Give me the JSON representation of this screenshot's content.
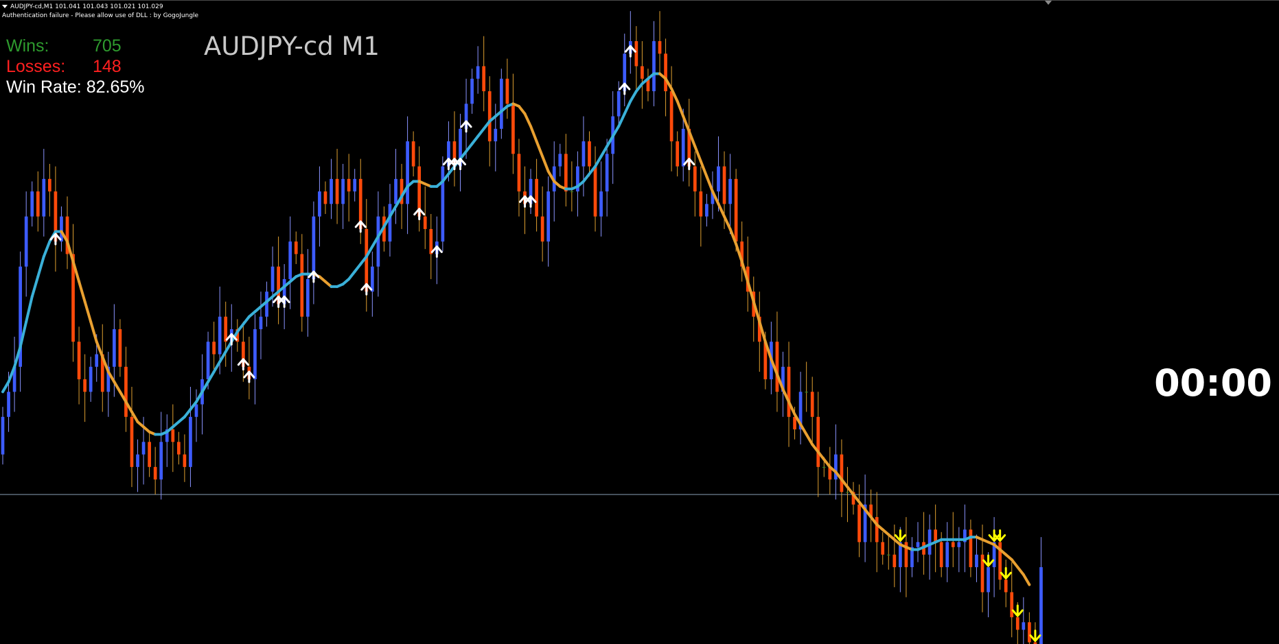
{
  "header": {
    "info_line": "AUDJPY-cd,M1  101.041 101.043 101.021 101.029",
    "status_line": "Authentication failure - Please allow use of DLL : by GogoJungle"
  },
  "stats": {
    "wins_label": "Wins:",
    "wins_value": "705",
    "losses_label": "Losses:",
    "losses_value": "148",
    "winrate_label": "Win Rate:",
    "winrate_value": "82.65%"
  },
  "chart_title": "AUDJPY-cd M1",
  "timer": "00:00",
  "colors": {
    "background": "#000000",
    "bull_candle": "#3d5cff",
    "bear_candle": "#ff4a0a",
    "doji_candle": "#2e8b2e",
    "wick_bull": "#8a94ff",
    "wick_bear": "#e0a030",
    "ma_up": "#3ab0d8",
    "ma_down": "#e9a030",
    "arrow_buy": "#ffffff",
    "arrow_sell": "#ffff00",
    "wins": "#2e9b2e",
    "losses": "#ff2020",
    "winrate": "#ffffff",
    "price_line": "#8aa0b8"
  },
  "chart_data": {
    "type": "candlestick",
    "symbol": "AUDJPY-cd",
    "timeframe": "M1",
    "y_range": [
      100.98,
      101.21
    ],
    "current_price": 101.029,
    "x_range": [
      0,
      178
    ],
    "closes": [
      101.06,
      101.07,
      101.08,
      101.12,
      101.14,
      101.15,
      101.14,
      101.155,
      101.15,
      101.13,
      101.14,
      101.125,
      101.09,
      101.075,
      101.07,
      101.08,
      101.085,
      101.07,
      101.08,
      101.095,
      101.08,
      101.06,
      101.04,
      101.045,
      101.05,
      101.04,
      101.035,
      101.05,
      101.055,
      101.05,
      101.045,
      101.04,
      101.06,
      101.065,
      101.075,
      101.09,
      101.085,
      101.1,
      101.09,
      101.095,
      101.09,
      101.08,
      101.075,
      101.095,
      101.1,
      101.11,
      101.12,
      101.105,
      101.115,
      101.13,
      101.125,
      101.1,
      101.115,
      101.14,
      101.15,
      101.145,
      101.155,
      101.145,
      101.155,
      101.15,
      101.155,
      101.135,
      101.11,
      101.12,
      101.14,
      101.13,
      101.145,
      101.155,
      101.145,
      101.17,
      101.16,
      101.14,
      101.135,
      101.125,
      101.13,
      101.16,
      101.17,
      101.16,
      101.175,
      101.185,
      101.195,
      101.2,
      101.19,
      101.17,
      101.175,
      101.195,
      101.185,
      101.165,
      101.15,
      101.145,
      101.155,
      101.14,
      101.13,
      101.15,
      101.16,
      101.165,
      101.15,
      101.15,
      101.16,
      101.17,
      101.16,
      101.14,
      101.15,
      101.165,
      101.18,
      101.19,
      101.205,
      101.21,
      101.2,
      101.195,
      101.19,
      101.21,
      101.205,
      101.19,
      101.17,
      101.16,
      101.175,
      101.16,
      101.15,
      101.14,
      101.145,
      101.15,
      101.16,
      101.145,
      101.155,
      101.13,
      101.12,
      101.11,
      101.1,
      101.09,
      101.075,
      101.09,
      101.07,
      101.08,
      101.06,
      101.055,
      101.07,
      101.07,
      101.06,
      101.04,
      101.04,
      101.035,
      101.045,
      101.03,
      101.03,
      101.025,
      101.01,
      101.025,
      101.02,
      101.01,
      101.005,
      101.005,
      101.0,
      101.01,
      101.0,
      101.008,
      101.01,
      101.005,
      101.015,
      101.01,
      101.0,
      101.01,
      101.008,
      101.01,
      101.015,
      101.0,
      101.005,
      100.99,
      101.0,
      101.01,
      100.995,
      100.99,
      100.98,
      100.975,
      100.978,
      100.97,
      100.965,
      101.0
    ],
    "opens": [
      101.045,
      101.06,
      101.07,
      101.08,
      101.12,
      101.14,
      101.15,
      101.14,
      101.155,
      101.15,
      101.13,
      101.14,
      101.125,
      101.09,
      101.075,
      101.07,
      101.08,
      101.085,
      101.07,
      101.08,
      101.095,
      101.08,
      101.06,
      101.04,
      101.045,
      101.05,
      101.04,
      101.035,
      101.05,
      101.055,
      101.05,
      101.045,
      101.04,
      101.06,
      101.065,
      101.075,
      101.09,
      101.085,
      101.1,
      101.09,
      101.095,
      101.09,
      101.08,
      101.075,
      101.095,
      101.1,
      101.11,
      101.12,
      101.105,
      101.115,
      101.13,
      101.125,
      101.1,
      101.115,
      101.14,
      101.15,
      101.145,
      101.155,
      101.145,
      101.155,
      101.15,
      101.155,
      101.135,
      101.11,
      101.12,
      101.14,
      101.13,
      101.145,
      101.155,
      101.145,
      101.17,
      101.16,
      101.14,
      101.135,
      101.125,
      101.13,
      101.16,
      101.17,
      101.16,
      101.175,
      101.185,
      101.195,
      101.2,
      101.19,
      101.17,
      101.175,
      101.195,
      101.185,
      101.165,
      101.15,
      101.145,
      101.155,
      101.14,
      101.13,
      101.15,
      101.16,
      101.165,
      101.15,
      101.15,
      101.16,
      101.17,
      101.16,
      101.14,
      101.15,
      101.165,
      101.18,
      101.19,
      101.205,
      101.21,
      101.2,
      101.195,
      101.19,
      101.21,
      101.205,
      101.19,
      101.17,
      101.16,
      101.175,
      101.16,
      101.15,
      101.14,
      101.145,
      101.15,
      101.16,
      101.145,
      101.155,
      101.13,
      101.12,
      101.11,
      101.1,
      101.09,
      101.075,
      101.09,
      101.07,
      101.08,
      101.06,
      101.055,
      101.07,
      101.07,
      101.06,
      101.04,
      101.04,
      101.035,
      101.045,
      101.03,
      101.03,
      101.025,
      101.01,
      101.025,
      101.02,
      101.01,
      101.005,
      101.005,
      101.0,
      101.01,
      101.0,
      101.008,
      101.01,
      101.005,
      101.015,
      101.01,
      101.0,
      101.01,
      101.008,
      101.01,
      101.015,
      101.0,
      101.005,
      100.99,
      101.0,
      101.01,
      100.995,
      100.99,
      100.98,
      100.975,
      100.978,
      100.97,
      100.965
    ],
    "ma_line": [
      101.07,
      101.074,
      101.08,
      101.088,
      101.098,
      101.108,
      101.116,
      101.124,
      101.13,
      101.134,
      101.134,
      101.13,
      101.122,
      101.114,
      101.106,
      101.098,
      101.09,
      101.084,
      101.078,
      101.074,
      101.07,
      101.066,
      101.062,
      101.058,
      101.056,
      101.054,
      101.053,
      101.053,
      101.054,
      101.056,
      101.058,
      101.06,
      101.063,
      101.066,
      101.07,
      101.074,
      101.078,
      101.082,
      101.086,
      101.09,
      101.094,
      101.097,
      101.1,
      101.102,
      101.104,
      101.106,
      101.108,
      101.11,
      101.112,
      101.114,
      101.116,
      101.117,
      101.117,
      101.117,
      101.116,
      101.114,
      101.112,
      101.112,
      101.113,
      101.115,
      101.118,
      101.121,
      101.124,
      101.128,
      101.132,
      101.136,
      101.14,
      101.144,
      101.148,
      101.152,
      101.154,
      101.154,
      101.153,
      101.152,
      101.152,
      101.154,
      101.157,
      101.16,
      101.163,
      101.166,
      101.169,
      101.172,
      101.175,
      101.178,
      101.18,
      101.182,
      101.184,
      101.185,
      101.184,
      101.181,
      101.176,
      101.17,
      101.164,
      101.158,
      101.154,
      101.152,
      101.151,
      101.151,
      101.152,
      101.154,
      101.157,
      101.16,
      101.164,
      101.168,
      101.172,
      101.176,
      101.181,
      101.186,
      101.19,
      101.193,
      101.195,
      101.197,
      101.197,
      101.195,
      101.191,
      101.186,
      101.18,
      101.174,
      101.168,
      101.162,
      101.156,
      101.15,
      101.145,
      101.14,
      101.135,
      101.129,
      101.122,
      101.114,
      101.106,
      101.098,
      101.09,
      101.083,
      101.077,
      101.071,
      101.066,
      101.061,
      101.057,
      101.053,
      101.049,
      101.046,
      101.043,
      101.04,
      101.038,
      101.035,
      101.032,
      101.029,
      101.026,
      101.023,
      101.02,
      101.017,
      101.015,
      101.013,
      101.011,
      101.009,
      101.008,
      101.007,
      101.007,
      101.008,
      101.009,
      101.01,
      101.011,
      101.011,
      101.011,
      101.011,
      101.011,
      101.012,
      101.012,
      101.011,
      101.01,
      101.009,
      101.007,
      101.005,
      101.003,
      101.0,
      100.997,
      100.993
    ],
    "buy_signals": [
      9,
      39,
      41,
      42,
      47,
      48,
      53,
      61,
      62,
      71,
      74,
      76,
      77,
      78,
      79,
      89,
      90,
      106,
      107,
      117
    ],
    "sell_signals": [
      153,
      169,
      168,
      171,
      170,
      173,
      176
    ]
  }
}
